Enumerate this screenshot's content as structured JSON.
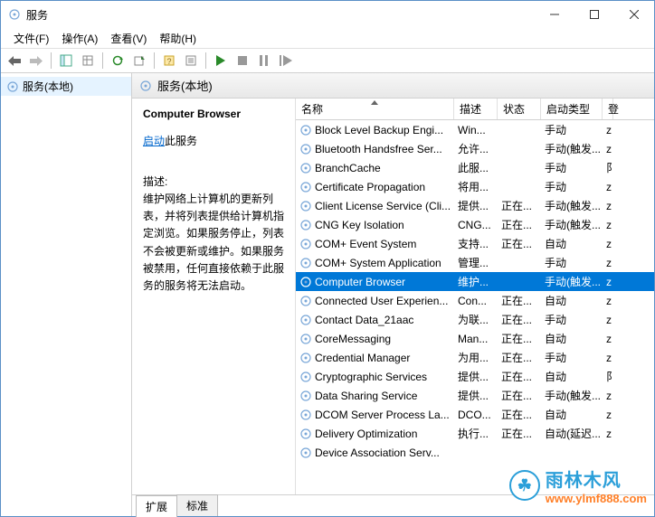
{
  "title": "服务",
  "menu": {
    "file": "文件(F)",
    "action": "操作(A)",
    "view": "查看(V)",
    "help": "帮助(H)"
  },
  "tree": {
    "root": "服务(本地)"
  },
  "panel": {
    "header": "服务(本地)"
  },
  "detail": {
    "title": "Computer Browser",
    "start_link": "启动",
    "start_suffix": "此服务",
    "desc_label": "描述:",
    "desc": "维护网络上计算机的更新列表，并将列表提供给计算机指定浏览。如果服务停止，列表不会被更新或维护。如果服务被禁用，任何直接依赖于此服务的服务将无法启动。"
  },
  "columns": {
    "name": "名称",
    "desc": "描述",
    "status": "状态",
    "startup": "启动类型",
    "extra": "登"
  },
  "services": [
    {
      "name": "Block Level Backup Engi...",
      "desc": "Win...",
      "status": "",
      "startup": "手动",
      "e": "z"
    },
    {
      "name": "Bluetooth Handsfree Ser...",
      "desc": "允许...",
      "status": "",
      "startup": "手动(触发...",
      "e": "z"
    },
    {
      "name": "BranchCache",
      "desc": "此服...",
      "status": "",
      "startup": "手动",
      "e": "阝"
    },
    {
      "name": "Certificate Propagation",
      "desc": "将用...",
      "status": "",
      "startup": "手动",
      "e": "z"
    },
    {
      "name": "Client License Service (Cli...",
      "desc": "提供...",
      "status": "正在...",
      "startup": "手动(触发...",
      "e": "z"
    },
    {
      "name": "CNG Key Isolation",
      "desc": "CNG...",
      "status": "正在...",
      "startup": "手动(触发...",
      "e": "z"
    },
    {
      "name": "COM+ Event System",
      "desc": "支持...",
      "status": "正在...",
      "startup": "自动",
      "e": "z"
    },
    {
      "name": "COM+ System Application",
      "desc": "管理...",
      "status": "",
      "startup": "手动",
      "e": "z"
    },
    {
      "name": "Computer Browser",
      "desc": "维护...",
      "status": "",
      "startup": "手动(触发...",
      "e": "z",
      "selected": true
    },
    {
      "name": "Connected User Experien...",
      "desc": "Con...",
      "status": "正在...",
      "startup": "自动",
      "e": "z"
    },
    {
      "name": "Contact Data_21aac",
      "desc": "为联...",
      "status": "正在...",
      "startup": "手动",
      "e": "z"
    },
    {
      "name": "CoreMessaging",
      "desc": "Man...",
      "status": "正在...",
      "startup": "自动",
      "e": "z"
    },
    {
      "name": "Credential Manager",
      "desc": "为用...",
      "status": "正在...",
      "startup": "手动",
      "e": "z"
    },
    {
      "name": "Cryptographic Services",
      "desc": "提供...",
      "status": "正在...",
      "startup": "自动",
      "e": "阝"
    },
    {
      "name": "Data Sharing Service",
      "desc": "提供...",
      "status": "正在...",
      "startup": "手动(触发...",
      "e": "z"
    },
    {
      "name": "DCOM Server Process La...",
      "desc": "DCO...",
      "status": "正在...",
      "startup": "自动",
      "e": "z"
    },
    {
      "name": "Delivery Optimization",
      "desc": "执行...",
      "status": "正在...",
      "startup": "自动(延迟...",
      "e": "z"
    },
    {
      "name": "Device Association Serv...",
      "desc": "",
      "status": "",
      "startup": "",
      "e": ""
    }
  ],
  "tabs": {
    "extended": "扩展",
    "standard": "标准"
  },
  "watermark": {
    "brand": "雨林木风",
    "url": "www.ylmf888.com"
  }
}
